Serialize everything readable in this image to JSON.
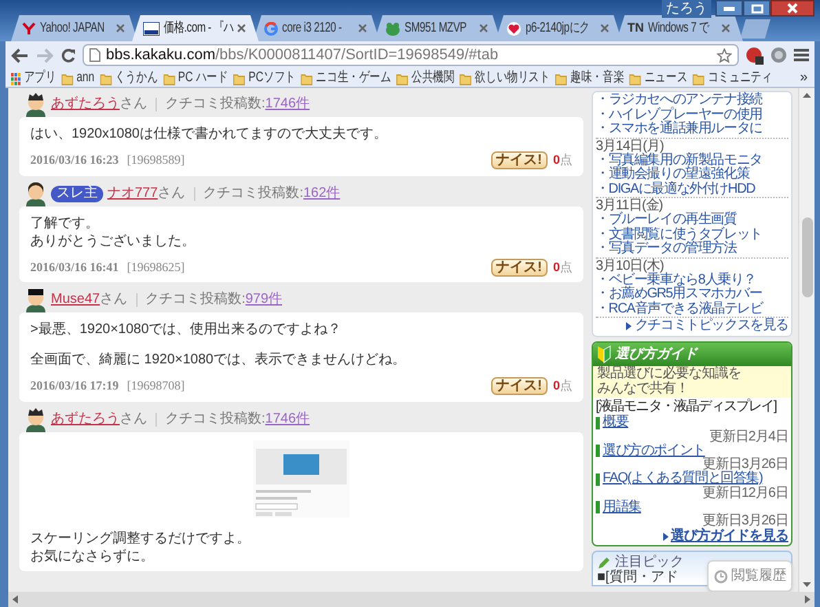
{
  "window": {
    "user": "たろう"
  },
  "tabs": [
    {
      "label": "Yahoo! JAPAN",
      "selected": false
    },
    {
      "label": "価格.com - 『ハ",
      "selected": true
    },
    {
      "label": "core i3 2120 -",
      "selected": false
    },
    {
      "label": "SM951 MZVP",
      "selected": false
    },
    {
      "label": "p6-2140jpにク",
      "selected": false
    },
    {
      "label": "Windows 7 で",
      "icon_text": "TN",
      "selected": false
    }
  ],
  "address": {
    "domain": "bbs.kakaku.com",
    "path": "/bbs/K0000811407/SortID=19698549/#tab"
  },
  "bookmarks": [
    {
      "label": "アプリ",
      "kind": "apps"
    },
    {
      "label": "ann",
      "kind": "folder"
    },
    {
      "label": "くうかん",
      "kind": "folder"
    },
    {
      "label": "PC ハード",
      "kind": "folder"
    },
    {
      "label": "PCソフト",
      "kind": "folder"
    },
    {
      "label": "ニコ生・ゲーム",
      "kind": "folder"
    },
    {
      "label": "公共機関",
      "kind": "folder"
    },
    {
      "label": "欲しい物リスト",
      "kind": "folder"
    },
    {
      "label": "趣味・音楽",
      "kind": "folder"
    },
    {
      "label": "ニュース",
      "kind": "folder"
    },
    {
      "label": "コミュニティ",
      "kind": "folder"
    }
  ],
  "bookmarks_more": "»",
  "posts": [
    {
      "author": "あずたろう",
      "honorific": "さん",
      "count_label": "クチコミ投稿数:",
      "count": "1746件",
      "paragraphs": [
        [
          "はい、1920x1080は仕様で書かれてますので大丈夫です。"
        ]
      ],
      "date": "2016/03/16 16:23",
      "post_id": "[19698589]",
      "nice": "ナイス!",
      "points": "0",
      "points_unit": "点"
    },
    {
      "badge": "スレ主",
      "author": "ナオ777",
      "honorific": "さん",
      "count_label": "クチコミ投稿数:",
      "count": "162件",
      "paragraphs": [
        [
          "了解です。",
          "ありがとうございました。"
        ]
      ],
      "date": "2016/03/16 16:41",
      "post_id": "[19698625]",
      "nice": "ナイス!",
      "points": "0",
      "points_unit": "点"
    },
    {
      "author": "Muse47",
      "honorific": "さん",
      "count_label": "クチコミ投稿数:",
      "count": "979件",
      "paragraphs": [
        [
          ">最悪、1920×1080では、使用出来るのですよね？"
        ],
        [
          "全画面で、綺麗に 1920×1080では、表示できませんけどね。"
        ]
      ],
      "date": "2016/03/16 17:19",
      "post_id": "[19698708]",
      "nice": "ナイス!",
      "points": "0",
      "points_unit": "点"
    },
    {
      "author": "あずたろう",
      "honorific": "さん",
      "count_label": "クチコミ投稿数:",
      "count": "1746件",
      "attachment": true,
      "paragraphs": [
        [
          "スケーリング調整するだけですよ。",
          "お気になさらずに。"
        ]
      ]
    }
  ],
  "topics": {
    "groups": [
      {
        "items": [
          "・ラジカセへのアンテナ接続",
          "・ハイレゾプレーヤーの使用",
          "・スマホを通話兼用ルータに"
        ]
      },
      {
        "date": "3月14日(月)",
        "items": [
          "・写真編集用の新製品モニタ",
          "・運動会撮りの望遠強化策",
          "・DIGAに最適な外付けHDD"
        ]
      },
      {
        "date": "3月11日(金)",
        "items": [
          "・ブルーレイの再生画質",
          "・文書閲覧に使うタブレット",
          "・写真データの管理方法"
        ]
      },
      {
        "date": "3月10日(木)",
        "items": [
          "・ベビー乗車なら8人乗り？",
          "・お薦めGR5用スマホカバー",
          "・RCA音声できる液晶テレビ"
        ]
      }
    ],
    "more": "クチコミトピックスを見る"
  },
  "guide": {
    "title": "選び方ガイド",
    "intro": [
      "製品選びに必要な知識を",
      "みんなで共有！"
    ],
    "category": "[液晶モニタ・液晶ディスプレイ]",
    "items": [
      {
        "label": "概要",
        "updated": "更新日2月4日"
      },
      {
        "label": "選び方のポイント",
        "updated": "更新日3月26日"
      },
      {
        "label": "FAQ(よくある質問と回答集)",
        "updated": "更新日12月6日"
      },
      {
        "label": "用語集",
        "updated": "更新日3月26日"
      }
    ],
    "more": "選び方ガイドを見る"
  },
  "pickup": {
    "title": "注目ピック",
    "items": [
      "■[質問・アド"
    ]
  },
  "history_button": "閲覧履歴"
}
